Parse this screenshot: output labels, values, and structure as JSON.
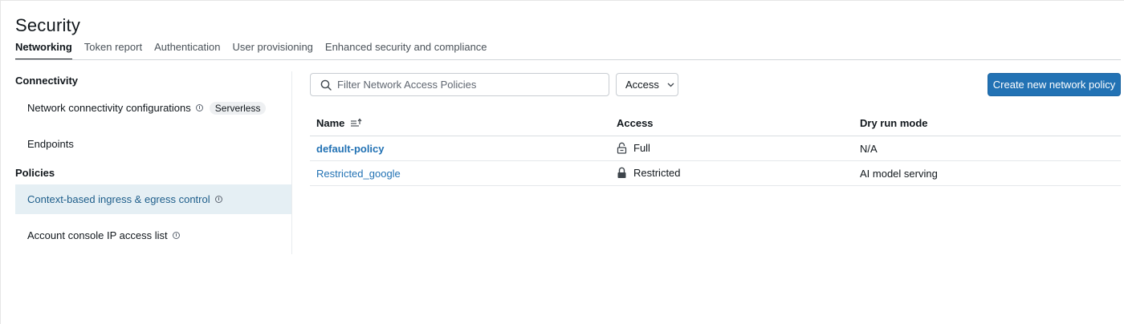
{
  "page": {
    "title": "Security"
  },
  "tabs": [
    {
      "label": "Networking",
      "active": true
    },
    {
      "label": "Token report",
      "active": false
    },
    {
      "label": "Authentication",
      "active": false
    },
    {
      "label": "User provisioning",
      "active": false
    },
    {
      "label": "Enhanced security and compliance",
      "active": false
    }
  ],
  "sidebar": {
    "sections": [
      {
        "heading": "Connectivity",
        "items": [
          {
            "label": "Network connectivity configurations",
            "icon": "info-icon",
            "badge": "Serverless"
          },
          {
            "label": "Endpoints"
          }
        ]
      },
      {
        "heading": "Policies",
        "items": [
          {
            "label": "Context-based ingress & egress control",
            "icon": "info-icon",
            "active": true
          },
          {
            "label": "Account console IP access list",
            "icon": "info-icon"
          }
        ]
      }
    ]
  },
  "toolbar": {
    "search_placeholder": "Filter Network Access Policies",
    "search_value": "",
    "access_filter_label": "Access",
    "create_button_label": "Create new network policy"
  },
  "table": {
    "columns": [
      "Name",
      "Access",
      "Dry run mode"
    ],
    "sort_icon": "sort-ascending-icon",
    "rows": [
      {
        "name": "default-policy",
        "access": "Full",
        "access_icon": "unlocked-icon",
        "dry_run": "N/A"
      },
      {
        "name": "Restricted_google",
        "access": "Restricted",
        "access_icon": "locked-icon",
        "dry_run": "AI model serving"
      }
    ]
  },
  "colors": {
    "accent": "#2272b4",
    "active_nav_bg": "#e5eff4",
    "active_nav_text": "#1d5d8a"
  }
}
